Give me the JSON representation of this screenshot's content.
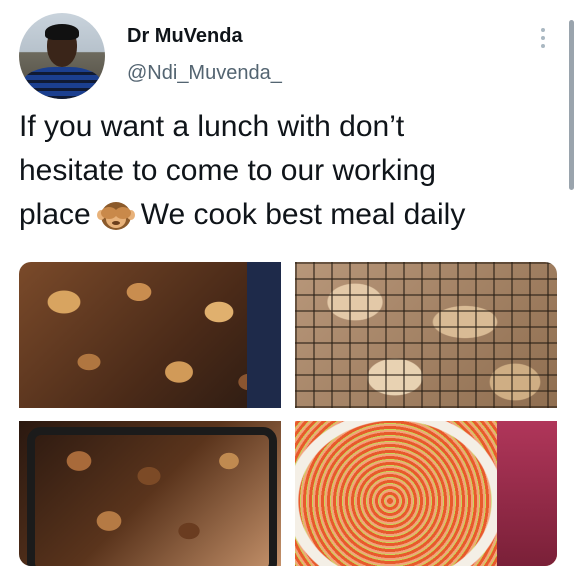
{
  "author": {
    "name": "Dr MuVenda",
    "handle": "@Ndi_Muvenda_"
  },
  "tweet": {
    "line1": "If you want a lunch with don’t",
    "line2": "hesitate to come to our working",
    "line3_before": "place",
    "emoji_icon": "see-no-evil-monkey-icon",
    "line3_after": "We cook best meal daily"
  },
  "media": {
    "count": 4,
    "images": [
      {
        "icon": "grilled-meat-photo"
      },
      {
        "icon": "chicken-on-grill-photo"
      },
      {
        "icon": "meat-in-tray-photo"
      },
      {
        "icon": "tomato-relish-photo"
      }
    ]
  },
  "colors": {
    "text": "#0f1419",
    "secondary": "#536471",
    "menu": "#aab8c2"
  }
}
